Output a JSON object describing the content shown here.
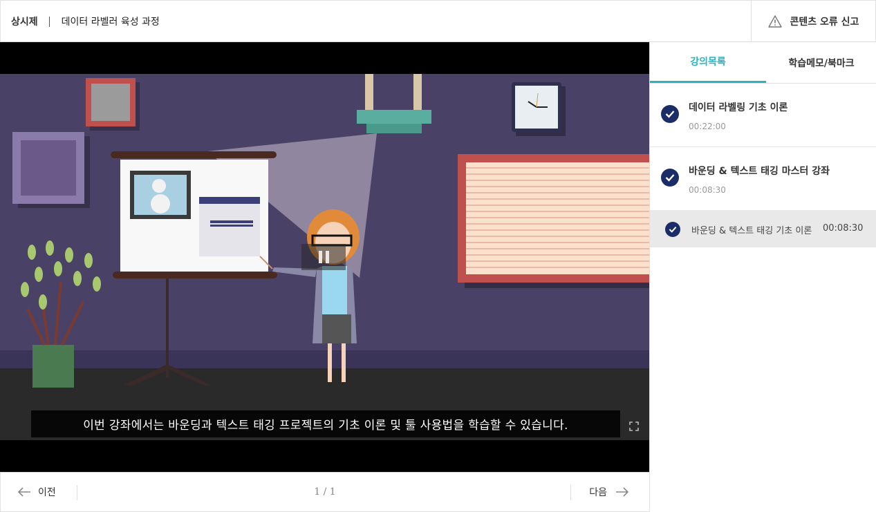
{
  "header": {
    "category": "상시제",
    "course_title": "데이터 라벨러 육성 과정",
    "report_label": "콘텐츠 오류 신고"
  },
  "video": {
    "caption": "이번 강좌에서는 바운딩과 텍스트 태깅 프로젝트의 기초 이론 및 툴 사용법을 학습할 수 있습니다."
  },
  "nav": {
    "prev_label": "이전",
    "next_label": "다음",
    "page_indicator": "1 / 1"
  },
  "sidebar": {
    "tabs": [
      {
        "label": "강의목록"
      },
      {
        "label": "학습메모/북마크"
      }
    ],
    "lessons": [
      {
        "title": "데이터 라벨링 기초 이론",
        "duration": "00:22:00"
      },
      {
        "title": "바운딩 & 텍스트 태깅 마스터 강좌",
        "duration": "00:08:30"
      }
    ],
    "sub_lessons": [
      {
        "title": "바운딩 & 텍스트 태깅 기초 이론",
        "duration": "00:08:30"
      }
    ]
  },
  "colors": {
    "accent": "#2ab3c0",
    "check": "#1b2d66",
    "wall": "#4a4266"
  }
}
